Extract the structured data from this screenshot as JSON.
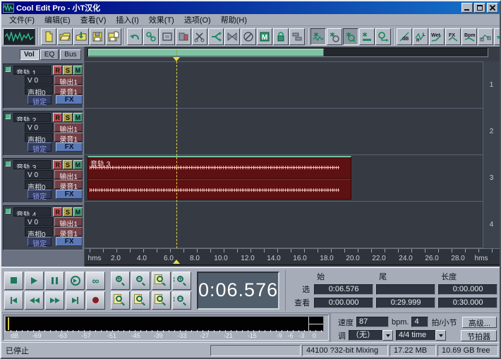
{
  "window": {
    "title": "Cool Edit Pro  - 小T汉化"
  },
  "menu": {
    "items": [
      "文件(F)",
      "编辑(E)",
      "查看(V)",
      "插入(I)",
      "效果(T)",
      "选项(O)",
      "帮助(H)"
    ]
  },
  "toolbar": {
    "icon_labels": {
      "db": "dB",
      "r": "R",
      "l": "L",
      "wet": "Wet",
      "fx": "FX",
      "bpm": "Bpm",
      "m": "M"
    }
  },
  "tabs": [
    "Vol",
    "EQ",
    "Bus"
  ],
  "track_shared": {
    "record": "R",
    "solo": "S",
    "mute": "M",
    "volume": "V 0",
    "out": "输出1",
    "pan": "声相0",
    "rec": "录音1",
    "lock": "锁定",
    "fx": "FX"
  },
  "tracks": [
    {
      "name": "音轨  1"
    },
    {
      "name": "音轨  2"
    },
    {
      "name": "音轨  3"
    },
    {
      "name": "音轨  4"
    }
  ],
  "clip": {
    "label": "音轨  3"
  },
  "track_numbers": [
    "1",
    "2",
    "3",
    "4"
  ],
  "ruler": {
    "unit_left": "hms",
    "unit_right": "hms",
    "ticks": [
      "2.0",
      "4.0",
      "6.0",
      "8.0",
      "10.0",
      "12.0",
      "14.0",
      "16.0",
      "18.0",
      "20.0",
      "22.0",
      "24.0",
      "26.0",
      "28.0"
    ]
  },
  "time_display": "0:06.576",
  "selection_panel": {
    "headers": {
      "start": "始",
      "end": "尾",
      "length": "长度"
    },
    "row_sel_label": "选",
    "row_view_label": "查看",
    "sel": {
      "start": "0:06.576",
      "end": "",
      "length": "0:00.000"
    },
    "view": {
      "start": "0:00.000",
      "end": "0:29.999",
      "length": "0:30.000"
    }
  },
  "session_panel": {
    "tempo_label": "速度",
    "tempo": "87",
    "tempo_unit": "bpm.",
    "beats": "4",
    "beats_label": "拍/小节",
    "advanced_button": "高级...",
    "key_label": "调",
    "key": "（无）",
    "time_signature": "4/4 time",
    "metronome_button": "节拍器"
  },
  "meter": {
    "ticks": [
      "dB",
      "-69",
      "-63",
      "-57",
      "-51",
      "-45",
      "-39",
      "-33",
      "-27",
      "-21",
      "-15",
      "-9",
      "-6",
      "-3",
      "0"
    ]
  },
  "statusbar": {
    "status": "已停止",
    "format": "44100 ?32-bit Mixing",
    "memory": "17.22 MB",
    "disk": "10.69 GB free"
  },
  "colors": {
    "accent_green": "#2fbd8f",
    "clip_red": "#5e1112",
    "waveform_pink": "#f0b4b4",
    "cursor_yellow": "#ead94e",
    "title_blue": "#000080"
  }
}
